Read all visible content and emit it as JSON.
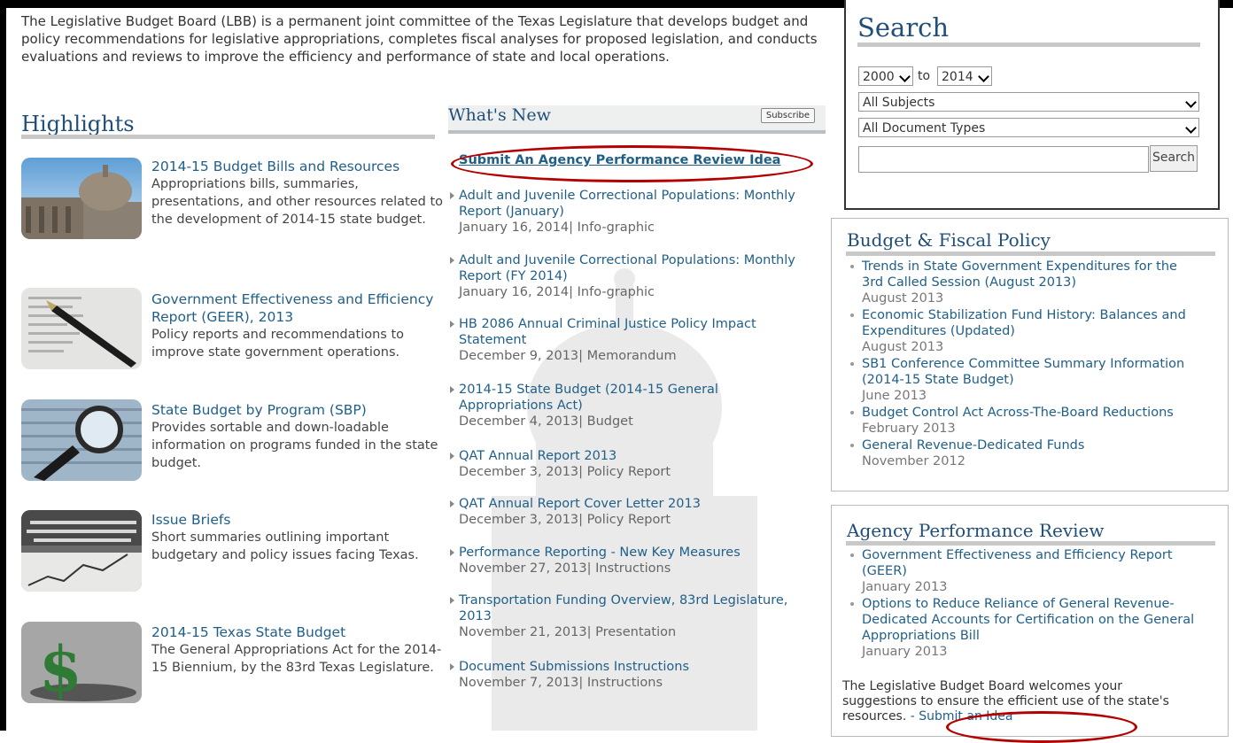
{
  "intro_text": "The Legislative Budget Board (LBB) is a permanent joint committee of the Texas Legislature that develops budget and policy recommendations for legislative appropriations, completes fiscal analyses for proposed legislation, and conducts evaluations and reviews to improve the efficiency and performance of state and local operations.",
  "highlights": {
    "title": "Highlights",
    "items": [
      {
        "title": "2014-15 Budget Bills and Resources",
        "desc": "Appropriations bills, summaries, presentations, and other resources related to the development of 2014-15 state budget.",
        "icon": "capitol-photo-icon"
      },
      {
        "title": "Government Effectiveness and Efficiency Report (GEER), 2013",
        "desc": "Policy reports and recommendations to improve state government operations.",
        "icon": "pen-on-paper-photo-icon"
      },
      {
        "title": "State Budget by Program (SBP)",
        "desc": "Provides sortable and down-loadable information on programs funded in the state budget.",
        "icon": "magnifying-glass-photo-icon"
      },
      {
        "title": "Issue Briefs",
        "desc": "Short summaries outlining important budgetary and policy issues facing Texas.",
        "icon": "newspaper-photo-icon"
      },
      {
        "title": "2014-15 Texas State Budget",
        "desc": "The General Appropriations Act for the 2014-15 Biennium, by the 83rd Texas Legislature.",
        "icon": "dollar-sign-photo-icon"
      }
    ]
  },
  "whats_new": {
    "title": "What's New",
    "subscribe_label": "Subscribe",
    "submit_link": "Submit An Agency Performance Review Idea",
    "items": [
      {
        "title": "Adult and Juvenile Correctional Populations: Monthly Report (January)",
        "meta": "January 16, 2014| Info-graphic"
      },
      {
        "title": "Adult and Juvenile Correctional Populations: Monthly Report (FY 2014)",
        "meta": "January 16, 2014| Info-graphic"
      },
      {
        "title": "HB 2086 Annual Criminal Justice Policy Impact Statement",
        "meta": "December 9, 2013| Memorandum"
      },
      {
        "title": "2014-15 State Budget (2014-15 General Appropriations Act)",
        "meta": "December 4, 2013| Budget"
      },
      {
        "title": "QAT Annual Report 2013",
        "meta": "December 3, 2013| Policy Report"
      },
      {
        "title": "QAT Annual Report Cover Letter 2013",
        "meta": "December 3, 2013| Policy Report"
      },
      {
        "title": "Performance Reporting - New Key Measures",
        "meta": "November 27, 2013| Instructions"
      },
      {
        "title": "Transportation Funding Overview, 83rd Legislature, 2013",
        "meta": "November 21, 2013| Presentation"
      },
      {
        "title": "Document Submissions Instructions",
        "meta": "November 7, 2013| Instructions"
      }
    ]
  },
  "search": {
    "title": "Search",
    "year_from": "2000",
    "to_label": "to",
    "year_to": "2014",
    "subjects": "All Subjects",
    "doc_types": "All Document Types",
    "query_placeholder": "",
    "button_label": "Search"
  },
  "budget_fiscal": {
    "title": "Budget & Fiscal Policy",
    "items": [
      {
        "title": "Trends in State Government Expenditures for the 3rd Called Session (August 2013)",
        "date": "August 2013"
      },
      {
        "title": "Economic Stabilization Fund History: Balances and Expenditures (Updated)",
        "date": "August 2013"
      },
      {
        "title": "SB1 Conference Committee Summary Information (2014-15 State Budget)",
        "date": "June 2013"
      },
      {
        "title": "Budget Control Act Across-The-Board Reductions",
        "date": "February 2013"
      },
      {
        "title": "General Revenue-Dedicated Funds",
        "date": "November 2012"
      }
    ]
  },
  "agency_review": {
    "title": "Agency Performance Review",
    "items": [
      {
        "title": "Government Effectiveness and Efficiency Report (GEER)",
        "date": "January 2013"
      },
      {
        "title": "Options to Reduce Reliance of General Revenue-Dedicated Accounts for Certification on the General Appropriations Bill",
        "date": "January 2013"
      }
    ],
    "welcome_text": "The Legislative Budget Board welcomes your suggestions to ensure the efficient use of the state's resources.",
    "submit_idea": " - Submit an Idea"
  },
  "colors": {
    "link": "#1f5f88",
    "heading": "#1f4e79",
    "annotation": "#b40000"
  }
}
